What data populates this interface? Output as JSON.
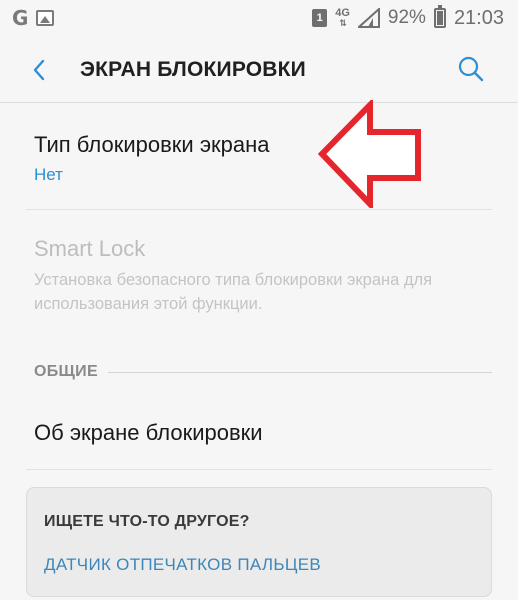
{
  "status_bar": {
    "network_type": "4G",
    "battery_percent": "92%",
    "time": "21:03",
    "sim_slot": "1"
  },
  "header": {
    "title": "ЭКРАН БЛОКИРОВКИ"
  },
  "items": [
    {
      "title": "Тип блокировки экрана",
      "subtitle": "Нет"
    },
    {
      "title": "Smart Lock",
      "description": "Установка безопасного типа блокировки экрана для использования этой функции.",
      "enabled": false
    }
  ],
  "section": {
    "label": "ОБЩИЕ",
    "items": [
      {
        "title": "Об экране блокировки"
      }
    ]
  },
  "suggestion_card": {
    "title": "ИЩЕТЕ ЧТО-ТО ДРУГОЕ?",
    "link": "ДАТЧИК ОТПЕЧАТКОВ ПАЛЬЦЕВ"
  },
  "colors": {
    "accent": "#2b8fd6",
    "annotation": "#e5262c",
    "background": "#f6f6f6"
  },
  "icons": [
    "google-g-icon",
    "image-icon",
    "sim-icon",
    "signal-icon",
    "battery-icon",
    "back-arrow-icon",
    "search-icon",
    "red-arrow-annotation"
  ]
}
